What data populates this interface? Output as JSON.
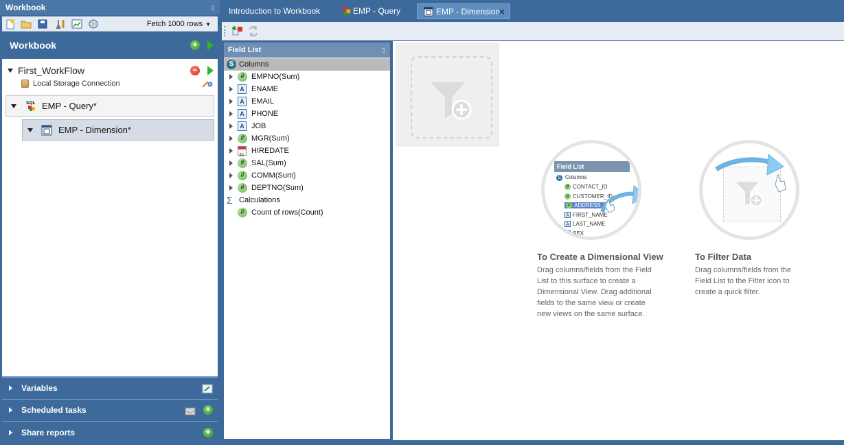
{
  "left_panel": {
    "pane_title": "Workbook",
    "fetch_label": "Fetch 1000 rows",
    "workbook_title": "Workbook",
    "workflow_name": "First_WorkFlow",
    "connection": "Local Storage Connection",
    "query_node": "EMP - Query*",
    "dimension_node": "EMP - Dimension*",
    "sections": [
      "Variables",
      "Scheduled tasks",
      "Share reports"
    ]
  },
  "tabs": [
    {
      "label": "Introduction to Workbook",
      "active": false
    },
    {
      "label": "EMP - Query",
      "active": false
    },
    {
      "label": "EMP - Dimension",
      "active": true
    }
  ],
  "field_list": {
    "title": "Field List",
    "columns_header": "Columns",
    "fields": [
      {
        "label": "EMPNO(Sum)",
        "icon": "number-icon"
      },
      {
        "label": "ENAME",
        "icon": "text-icon"
      },
      {
        "label": "EMAIL",
        "icon": "text-icon"
      },
      {
        "label": "PHONE",
        "icon": "text-icon"
      },
      {
        "label": "JOB",
        "icon": "text-icon"
      },
      {
        "label": "MGR(Sum)",
        "icon": "number-icon"
      },
      {
        "label": "HIREDATE",
        "icon": "calendar-icon"
      },
      {
        "label": "SAL(Sum)",
        "icon": "number-icon"
      },
      {
        "label": "COMM(Sum)",
        "icon": "number-icon"
      },
      {
        "label": "DEPTNO(Sum)",
        "icon": "number-icon"
      }
    ],
    "calculations_header": "Calculations",
    "calculations": [
      {
        "label": "Count of rows(Count)",
        "icon": "number-icon"
      }
    ]
  },
  "illustration": {
    "panel_title": "Field List",
    "columns": "Columns",
    "items": [
      "CONTACT_ID",
      "CUSTOMER_ID",
      "ADDRESS_ID",
      "FIRST_NAME",
      "LAST_NAME",
      "SEX"
    ]
  },
  "help": {
    "create_title": "To Create a Dimensional View",
    "create_lines": [
      "Drag columns/fields from the Field",
      "List to this surface to create a",
      "Dimensional View. Drag additional",
      "fields to the same view or create",
      "new views on the same surface."
    ],
    "filter_title": "To Filter Data",
    "filter_lines": [
      "Drag columns/fields from the",
      "Field List to the Filter icon to",
      "create a quick filter."
    ]
  },
  "colors": {
    "chrome_blue": "#3d6a9a",
    "active_tab": "#5d8cbf",
    "selection": "#5b86c4",
    "add_green": "#2f9a23",
    "remove_red": "#d42b1d"
  }
}
